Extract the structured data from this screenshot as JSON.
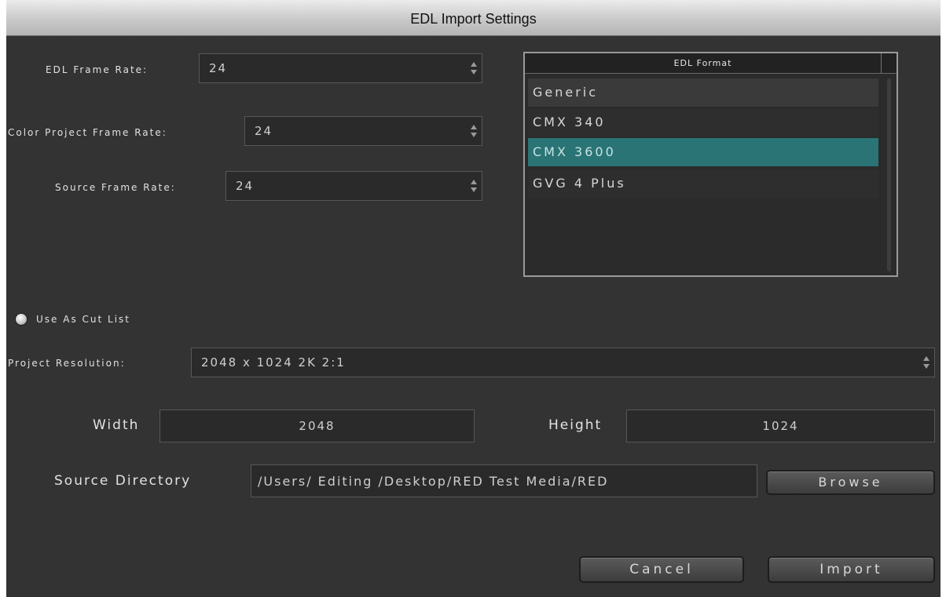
{
  "window": {
    "title": "EDL Import Settings"
  },
  "frame_rates": {
    "edl_label": "EDL Frame Rate:",
    "edl_value": "24",
    "color_project_label": "Color Project Frame Rate:",
    "color_project_value": "24",
    "source_label": "Source Frame Rate:",
    "source_value": "24"
  },
  "edl_format": {
    "header": "EDL Format",
    "items": [
      {
        "label": "Generic",
        "selected": false
      },
      {
        "label": "CMX 340",
        "selected": false
      },
      {
        "label": "CMX 3600",
        "selected": true
      },
      {
        "label": "GVG 4 Plus",
        "selected": false
      }
    ],
    "selected_color": "#2a7476"
  },
  "cut_list": {
    "label": "Use As Cut List"
  },
  "resolution": {
    "label": "Project Resolution:",
    "value": "2048 x 1024 2K 2:1",
    "width_label": "Width",
    "width_value": "2048",
    "height_label": "Height",
    "height_value": "1024"
  },
  "source_directory": {
    "label": "Source Directory",
    "value": "/Users/ Editing /Desktop/RED Test Media/RED",
    "browse_label": "Browse"
  },
  "actions": {
    "cancel_label": "Cancel",
    "import_label": "Import"
  }
}
